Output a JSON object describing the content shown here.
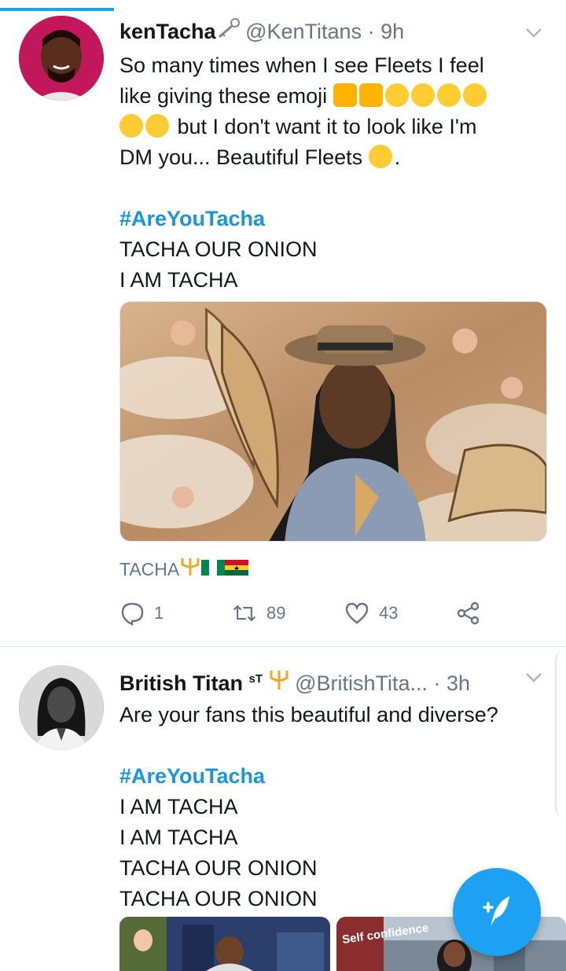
{
  "tweet1": {
    "display_name": "kenTacha",
    "handle": "@KenTitans",
    "time": "· 9h",
    "text_line1": "So many times when I see Fleets I feel",
    "text_line2": "like giving these emoji",
    "text_line3": "but I don't want it to look like I'm",
    "text_line4": "DM you... Beautiful Fleets",
    "text_line4_end": ".",
    "hashtag": "#AreYouTacha",
    "line5": "TACHA OUR ONION",
    "line6": "I AM TACHA",
    "caption": "TACHA",
    "replies": "1",
    "retweets": "89",
    "likes": "43"
  },
  "tweet2": {
    "display_name": "British Titan",
    "superscript": "sT",
    "handle": "@BritishTita...",
    "time": "· 3h",
    "text_line1": "Are your fans this beautiful and diverse?",
    "hashtag": "#AreYouTacha",
    "line3": "I AM TACHA",
    "line4": "I AM TACHA",
    "line5": "TACHA OUR ONION",
    "line6": "TACHA OUR ONION",
    "thumb2_text": "Self confidence"
  },
  "colors": {
    "accent": "#1da1f2",
    "link": "#1b95e0",
    "muted": "#657786"
  },
  "icons": [
    "key-icon",
    "trident-icon",
    "reply-icon",
    "retweet-icon",
    "like-icon",
    "share-icon",
    "compose-icon",
    "caret-down-icon"
  ]
}
